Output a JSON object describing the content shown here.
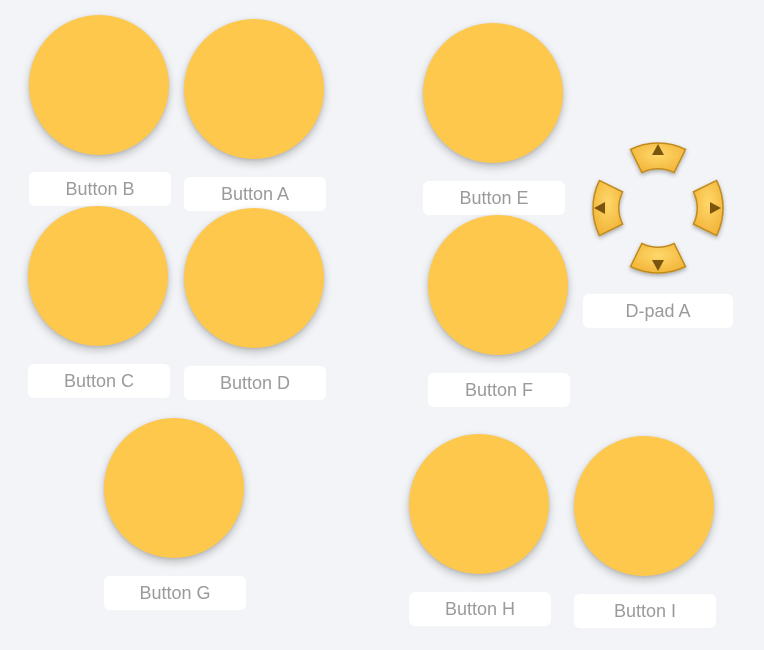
{
  "buttons": {
    "a": {
      "label": "Button A"
    },
    "b": {
      "label": "Button B"
    },
    "c": {
      "label": "Button C"
    },
    "d": {
      "label": "Button D"
    },
    "e": {
      "label": "Button E"
    },
    "f": {
      "label": "Button F"
    },
    "g": {
      "label": "Button G"
    },
    "h": {
      "label": "Button H"
    },
    "i": {
      "label": "Button I"
    }
  },
  "dpad": {
    "label": "D-pad A",
    "directions": [
      "up-arrow-icon",
      "down-arrow-icon",
      "left-arrow-icon",
      "right-arrow-icon"
    ]
  },
  "colors": {
    "background": "#f2f4f7",
    "button_fill": "#fec84c",
    "dpad_fill": "#f8c449",
    "dpad_stroke": "#c08a1a",
    "arrow": "#7a5510",
    "label_bg": "#ffffff",
    "label_text": "#9a9a9a"
  }
}
